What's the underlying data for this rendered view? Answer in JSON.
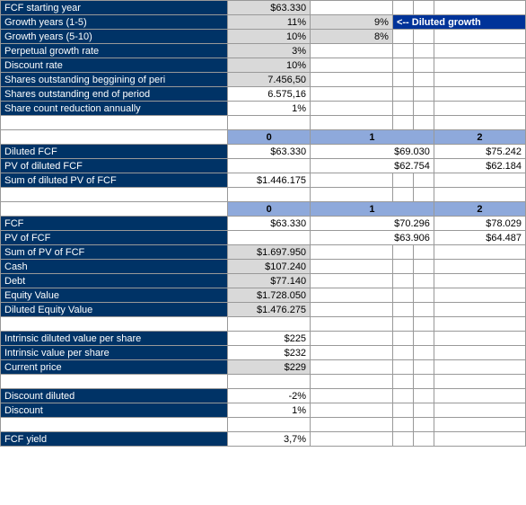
{
  "rows": {
    "fcf_start_label": "FCF starting year",
    "fcf_start_val": "$63.330",
    "g15_label": "Growth years (1-5)",
    "g15_a": "11%",
    "g15_b": "9%",
    "note": "<-- Diluted growth",
    "g510_label": "Growth years (5-10)",
    "g510_a": "10%",
    "g510_b": "8%",
    "perp_label": "Perpetual growth rate",
    "perp_val": "3%",
    "disc_label": "Discount rate",
    "disc_val": "10%",
    "sob_label": "Shares outstanding beggining of peri",
    "sob_val": "7.456,50",
    "soe_label": "Shares outstanding end of period",
    "soe_val": "6.575,16",
    "scr_label": "Share count reduction annually",
    "scr_val": "1%",
    "h0": "0",
    "h1": "1",
    "h2": "2",
    "dfcf_label": "Diluted FCF",
    "dfcf_0": "$63.330",
    "dfcf_1": "$69.030",
    "dfcf_2": "$75.242",
    "pvd_label": "PV of  diluted FCF",
    "pvd_1": "$62.754",
    "pvd_2": "$62.184",
    "sumd_label": "Sum of diluted PV of FCF",
    "sumd_val": "$1.446.175",
    "fcf_label": "FCF",
    "fcf_0": "$63.330",
    "fcf_1": "$70.296",
    "fcf_2": "$78.029",
    "pvf_label": "PV of FCF",
    "pvf_1": "$63.906",
    "pvf_2": "$64.487",
    "sumf_label": "Sum of PV of FCF",
    "sumf_val": "$1.697.950",
    "cash_label": "Cash",
    "cash_val": "$107.240",
    "debt_label": "Debt",
    "debt_val": "$77.140",
    "eqv_label": "Equity Value",
    "eqv_val": "$1.728.050",
    "deqv_label": "Diluted Equity Value",
    "deqv_val": "$1.476.275",
    "idv_label": "Intrinsic diluted value per share",
    "idv_val": "$225",
    "iv_label": "Intrinsic value per share",
    "iv_val": "$232",
    "cp_label": "Current price",
    "cp_val": "$229",
    "dd_label": "Discount diluted",
    "dd_val": "-2%",
    "d_label": "Discount",
    "d_val": "1%",
    "fy_label": "FCF yield",
    "fy_val": "3,7%"
  }
}
